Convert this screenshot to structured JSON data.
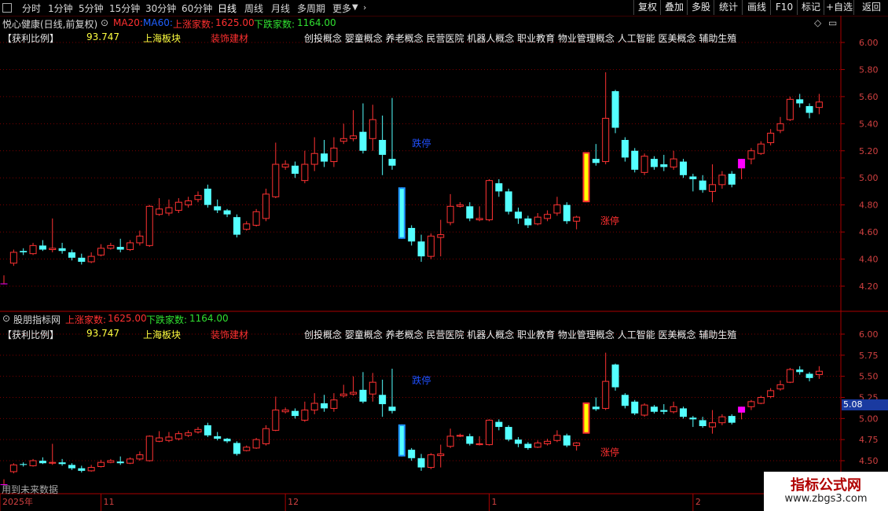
{
  "toolbar": {
    "periods": [
      "分时",
      "1分钟",
      "5分钟",
      "15分钟",
      "30分钟",
      "60分钟",
      "日线",
      "周线",
      "月线",
      "多周期",
      "更多"
    ],
    "active_period": "日线",
    "buttons": [
      "复权",
      "叠加",
      "多股",
      "统计",
      "画线",
      "F10",
      "标记",
      "+自选",
      "返回"
    ]
  },
  "top_panel": {
    "title": "悦心健康(日线,前复权)",
    "ma20": "MA20:",
    "ma60": "MA60:",
    "up_label": "上涨家数:",
    "up_value": "1625.00",
    "down_label": "下跌家数:",
    "down_value": "1164.00",
    "profit_label": "【获利比例】",
    "profit_value": "93.747",
    "board": "上海板块",
    "industry": "装饰建材",
    "concepts": "创投概念 婴童概念 养老概念 民营医院 机器人概念 职业教育 物业管理概念 人工智能 医美概念 辅助生殖",
    "y_ticks": [
      "6.00",
      "5.80",
      "5.60",
      "5.40",
      "5.20",
      "5.00",
      "4.80",
      "4.60",
      "4.40",
      "4.20"
    ],
    "y_range": [
      4.1,
      6.1
    ]
  },
  "bottom_panel": {
    "title": "股朋指标网",
    "up_label": "上涨家数:",
    "up_value": "1625.00",
    "down_label": "下跌家数:",
    "down_value": "1164.00",
    "profit_label": "【获利比例】",
    "profit_value": "93.747",
    "board": "上海板块",
    "industry": "装饰建材",
    "concepts": "创投概念 婴童概念 养老概念 民营医院 机器人概念 职业教育 物业管理概念 人工智能 医美概念 辅助生殖",
    "y_ticks": [
      "6.00",
      "5.75",
      "5.50",
      "5.25",
      "5.00",
      "4.75",
      "4.50"
    ],
    "y_range": [
      4.42,
      6.08
    ],
    "current_price": "5.08",
    "footer_note": "用到未来数据"
  },
  "x_axis": {
    "labels": [
      "2025年",
      "11",
      "12",
      "1",
      "2"
    ]
  },
  "annotations": {
    "limit_down": "跌停",
    "limit_up": "涨停"
  },
  "watermark": {
    "title": "指标公式网",
    "url": "www.zbgs3.com"
  },
  "colors": {
    "up": "#ff3232",
    "down": "#54ffff",
    "limit_down_bar": "#1e90ff",
    "limit_up_bar": "#ffff00",
    "signal": "#ff00ff",
    "grid": "#7a0000"
  },
  "chart_data": {
    "type": "candlestick",
    "ohlc": [
      [
        4.22,
        4.22,
        4.22,
        4.28
      ],
      [
        4.37,
        4.45,
        4.35,
        4.47
      ],
      [
        4.46,
        4.45,
        4.43,
        4.48
      ],
      [
        4.44,
        4.5,
        4.43,
        4.52
      ],
      [
        4.5,
        4.47,
        4.46,
        4.54
      ],
      [
        4.47,
        4.48,
        4.45,
        4.7
      ],
      [
        4.48,
        4.46,
        4.44,
        4.52
      ],
      [
        4.45,
        4.41,
        4.39,
        4.47
      ],
      [
        4.41,
        4.38,
        4.36,
        4.44
      ],
      [
        4.38,
        4.42,
        4.37,
        4.45
      ],
      [
        4.43,
        4.48,
        4.42,
        4.51
      ],
      [
        4.48,
        4.5,
        4.47,
        4.52
      ],
      [
        4.49,
        4.47,
        4.45,
        4.55
      ],
      [
        4.47,
        4.52,
        4.46,
        4.54
      ],
      [
        4.52,
        4.57,
        4.5,
        4.61
      ],
      [
        4.5,
        4.79,
        4.49,
        4.8
      ],
      [
        4.73,
        4.77,
        4.72,
        4.85
      ],
      [
        4.74,
        4.78,
        4.72,
        4.84
      ],
      [
        4.76,
        4.82,
        4.74,
        4.85
      ],
      [
        4.8,
        4.83,
        4.78,
        4.86
      ],
      [
        4.84,
        4.87,
        4.82,
        4.9
      ],
      [
        4.92,
        4.8,
        4.78,
        4.95
      ],
      [
        4.79,
        4.76,
        4.74,
        4.84
      ],
      [
        4.76,
        4.73,
        4.71,
        4.77
      ],
      [
        4.71,
        4.58,
        4.56,
        4.73
      ],
      [
        4.62,
        4.66,
        4.61,
        4.68
      ],
      [
        4.65,
        4.75,
        4.64,
        4.77
      ],
      [
        4.7,
        4.88,
        4.68,
        4.92
      ],
      [
        4.86,
        5.1,
        4.85,
        5.26
      ],
      [
        5.08,
        5.1,
        5.06,
        5.13
      ],
      [
        5.09,
        5.03,
        5.0,
        5.12
      ],
      [
        4.98,
        5.1,
        4.96,
        5.2
      ],
      [
        5.1,
        5.18,
        5.05,
        5.3
      ],
      [
        5.18,
        5.12,
        5.08,
        5.28
      ],
      [
        5.12,
        5.22,
        5.08,
        5.3
      ],
      [
        5.27,
        5.29,
        5.25,
        5.4
      ],
      [
        5.29,
        5.31,
        5.27,
        5.5
      ],
      [
        5.34,
        5.2,
        5.18,
        5.55
      ],
      [
        5.29,
        5.43,
        5.2,
        5.54
      ],
      [
        5.28,
        5.17,
        5.02,
        5.46
      ],
      [
        5.14,
        5.09,
        5.06,
        5.59
      ],
      [
        4.93,
        4.55,
        4.55,
        4.93
      ],
      [
        4.63,
        4.53,
        4.5,
        4.65
      ],
      [
        4.53,
        4.42,
        4.38,
        4.58
      ],
      [
        4.42,
        4.57,
        4.4,
        4.59
      ],
      [
        4.56,
        4.58,
        4.42,
        4.69
      ],
      [
        4.67,
        4.79,
        4.65,
        4.88
      ],
      [
        4.79,
        4.8,
        4.78,
        4.82
      ],
      [
        4.79,
        4.7,
        4.68,
        4.82
      ],
      [
        4.69,
        4.7,
        4.68,
        4.79
      ],
      [
        4.69,
        4.98,
        4.68,
        4.99
      ],
      [
        4.96,
        4.9,
        4.86,
        4.99
      ],
      [
        4.9,
        4.75,
        4.73,
        4.92
      ],
      [
        4.75,
        4.7,
        4.66,
        4.78
      ],
      [
        4.7,
        4.65,
        4.63,
        4.72
      ],
      [
        4.66,
        4.71,
        4.65,
        4.74
      ],
      [
        4.7,
        4.73,
        4.68,
        4.76
      ],
      [
        4.74,
        4.8,
        4.72,
        4.86
      ],
      [
        4.8,
        4.68,
        4.66,
        4.82
      ],
      [
        4.68,
        4.71,
        4.62,
        4.72
      ],
      [
        4.82,
        5.19,
        4.82,
        5.19
      ],
      [
        5.14,
        5.11,
        5.09,
        5.25
      ],
      [
        5.12,
        5.44,
        5.1,
        5.78
      ],
      [
        5.64,
        5.37,
        5.33,
        5.65
      ],
      [
        5.28,
        5.15,
        5.12,
        5.3
      ],
      [
        5.2,
        5.06,
        5.04,
        5.22
      ],
      [
        5.04,
        5.16,
        5.02,
        5.18
      ],
      [
        5.14,
        5.08,
        5.06,
        5.16
      ],
      [
        5.1,
        5.08,
        5.05,
        5.17
      ],
      [
        5.08,
        5.14,
        5.06,
        5.2
      ],
      [
        5.12,
        5.02,
        5.0,
        5.14
      ],
      [
        5.01,
        4.99,
        4.9,
        5.03
      ],
      [
        4.98,
        4.91,
        4.89,
        5.02
      ],
      [
        4.9,
        4.95,
        4.82,
        5.1
      ],
      [
        4.95,
        5.02,
        4.92,
        5.05
      ],
      [
        5.03,
        4.95,
        4.93,
        5.05
      ],
      [
        5.07,
        5.14,
        4.99,
        5.14
      ],
      [
        5.14,
        5.2,
        5.1,
        5.22
      ],
      [
        5.18,
        5.25,
        5.17,
        5.27
      ],
      [
        5.26,
        5.33,
        5.24,
        5.36
      ],
      [
        5.35,
        5.4,
        5.33,
        5.45
      ],
      [
        5.43,
        5.58,
        5.42,
        5.6
      ],
      [
        5.58,
        5.55,
        5.52,
        5.62
      ],
      [
        5.53,
        5.48,
        5.44,
        5.55
      ],
      [
        5.52,
        5.56,
        5.47,
        5.62
      ]
    ],
    "limit_down_indices": [
      41
    ],
    "limit_up_indices": [
      60
    ],
    "signal_indices": [
      0,
      76
    ],
    "x_label_indices": [
      0,
      10,
      29,
      50,
      71
    ]
  }
}
